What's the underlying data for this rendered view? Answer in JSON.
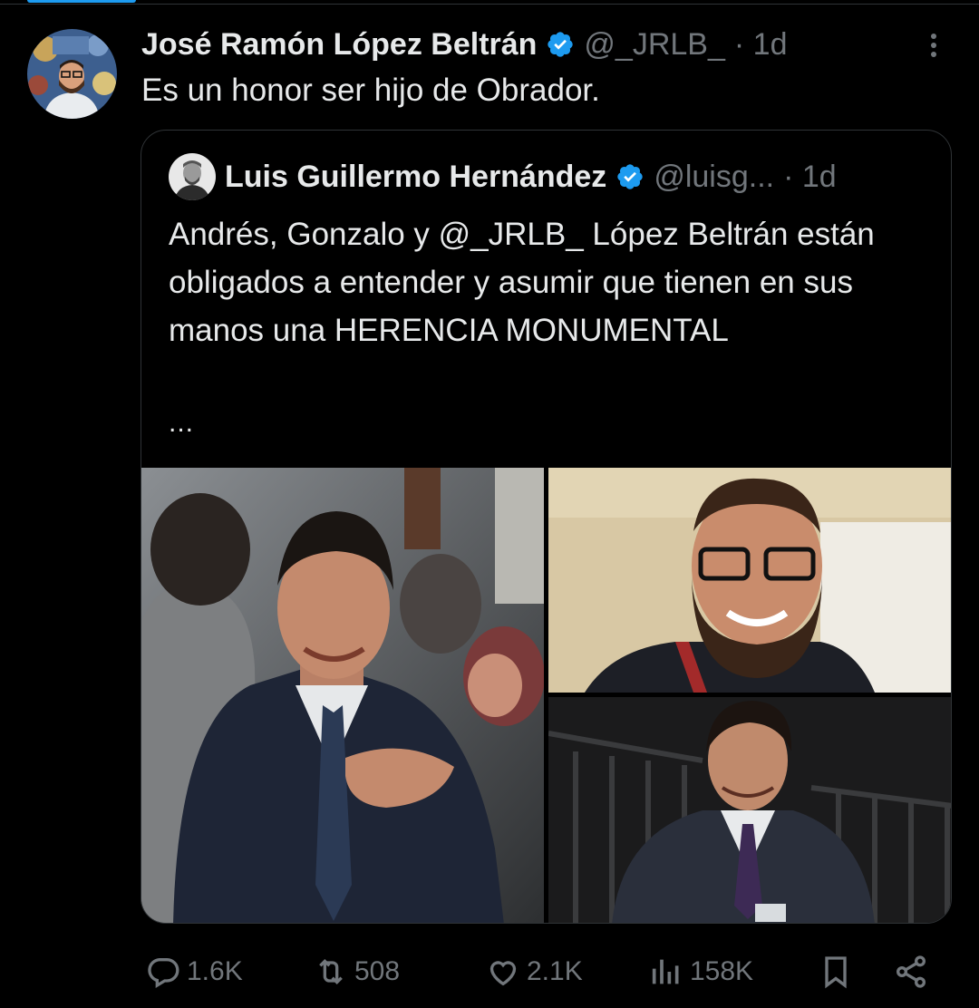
{
  "tweet": {
    "author_name": "José Ramón López Beltrán",
    "handle": "@_JRLB_",
    "time": "· 1d",
    "text": "Es un honor ser hijo de Obrador."
  },
  "quoted_tweet": {
    "author_name": "Luis Guillermo Hernández",
    "handle": "@luisg...",
    "time": "· 1d",
    "text": "Andrés, Gonzalo y @_JRLB_ López Beltrán están obligados a entender y asumir que tienen en sus manos una HERENCIA MONUMENTAL",
    "ellipsis": "...",
    "media": [
      "photo",
      "photo",
      "photo"
    ]
  },
  "actions": {
    "replies": "1.6K",
    "reposts": "508",
    "likes": "2.1K",
    "views": "158K"
  },
  "icons": [
    "verified-icon",
    "more-icon",
    "reply-icon",
    "repost-icon",
    "like-icon",
    "views-icon",
    "bookmark-icon",
    "share-icon"
  ],
  "colors": {
    "background": "#000000",
    "text": "#e7e9ea",
    "muted": "#71767b",
    "accent": "#1d9bf0",
    "border": "#2f3336"
  }
}
